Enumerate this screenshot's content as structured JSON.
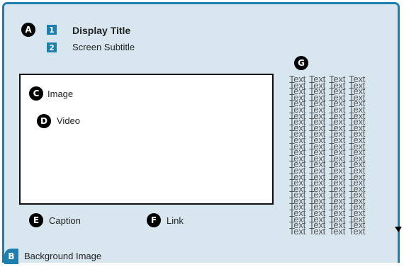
{
  "markers": {
    "a": "A",
    "b": "B",
    "c": "C",
    "d": "D",
    "e": "E",
    "f": "F",
    "g": "G",
    "n1": "1",
    "n2": "2"
  },
  "labels": {
    "display_title": "Display Title",
    "screen_subtitle": "Screen Subtitle",
    "image": "Image",
    "video": "Video",
    "caption": "Caption",
    "link": "Link",
    "background_image": "Background Image",
    "text_word": "Text"
  },
  "text_block": {
    "rows": 26,
    "columns": 4
  },
  "colors": {
    "accent": "#1c7fae",
    "panel": "#d8e6ef",
    "marker": "#000000"
  },
  "icons": {
    "scroll_indicator": "scroll-down-arrow-icon"
  }
}
